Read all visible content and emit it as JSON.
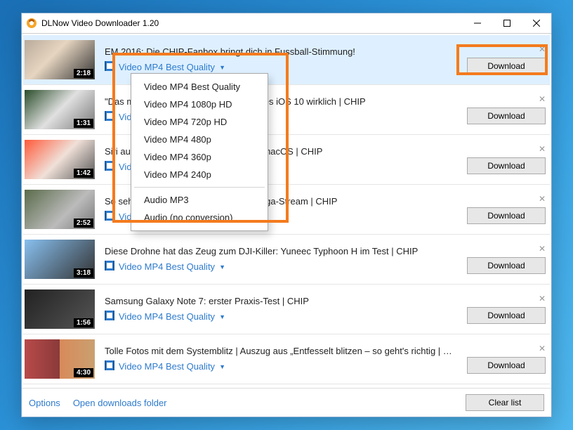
{
  "window": {
    "title": "DLNow Video Downloader 1.20"
  },
  "buttons": {
    "download": "Download",
    "clear_list": "Clear list",
    "options": "Options",
    "open_downloads": "Open downloads folder"
  },
  "quality_label": "Video MP4 Best Quality",
  "items": [
    {
      "duration": "2:18",
      "title": "EM 2016: Die CHIP-Fanbox bringt dich in Fussball-Stimmung!",
      "selected": true
    },
    {
      "duration": "1:31",
      "title": "\"Das meiste ist geklaut\": So gut ist Apples iOS 10 wirklich | CHIP"
    },
    {
      "duration": "1:42",
      "title": "Siri auf dem Mac: So cool ist das neue macOS | CHIP"
    },
    {
      "duration": "2:52",
      "title": "So sehen Sie den kostenlosen Bundesliga-Stream | CHIP"
    },
    {
      "duration": "3:18",
      "title": "Diese Drohne hat das Zeug zum DJI-Killer: Yuneec Typhoon H im Test | CHIP"
    },
    {
      "duration": "1:56",
      "title": "Samsung Galaxy Note 7: erster Praxis-Test | CHIP"
    },
    {
      "duration": "4:30",
      "title": "Tolle Fotos mit dem Systemblitz | Auszug aus „Entfesselt blitzen – so geht's richtig | CHIP A..."
    }
  ],
  "dropdown": {
    "group1": [
      "Video MP4 Best Quality",
      "Video MP4 1080p HD",
      "Video MP4 720p HD",
      "Video MP4 480p",
      "Video MP4 360p",
      "Video MP4 240p"
    ],
    "group2": [
      "Audio MP3",
      "Audio (no conversion)"
    ]
  }
}
